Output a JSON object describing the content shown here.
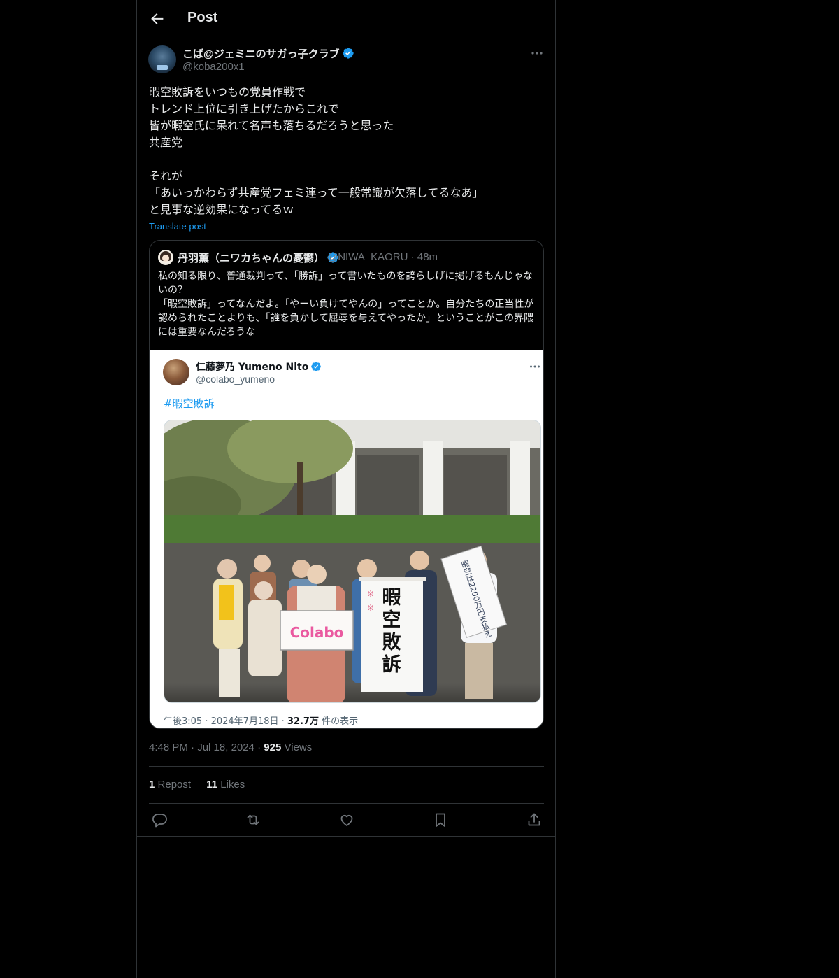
{
  "header": {
    "title": "Post"
  },
  "post": {
    "author_name": "こば@ジェミニのサガっ子クラブ",
    "author_handle": "@koba200x1",
    "body": "暇空敗訴をいつもの党員作戦で\nトレンド上位に引き上げたからこれで\n皆が暇空氏に呆れて名声も落ちるだろうと思った\n共産党\n\nそれが\n「あいっかわらず共産党フェミ連って一般常識が欠落してるなあ」\nと見事な逆効果になってるｗ",
    "translate_label": "Translate post",
    "time": "4:48 PM",
    "date": "Jul 18, 2024",
    "views_count": "925",
    "views_label": "Views",
    "reposts_count": "1",
    "reposts_label": "Repost",
    "likes_count": "11",
    "likes_label": "Likes"
  },
  "quote": {
    "author_name": "丹羽薫（ニワカちゃんの憂鬱）",
    "author_handle": "@NIWA_KAORU",
    "age": "48m",
    "text": "私の知る限り、普通裁判って、「勝訴」って書いたものを誇らしげに掲げるもんじゃないの？\n「暇空敗訴」ってなんだよ。「やーい負けてやんの」ってことか。自分たちの正当性が認められたことよりも、「誰を負かして屈辱を与えてやったか」ということがこの界隈には重要なんだろうな"
  },
  "embed": {
    "author_name": "仁藤夢乃 Yumeno Nito",
    "author_handle": "@colabo_yumeno",
    "hashtag": "#暇空敗訴",
    "photo": {
      "banner_text": [
        "暇",
        "空",
        "敗",
        "訴"
      ],
      "sign_text": "Colabo",
      "handwritten_sign": "暇空は2200万円支払え"
    },
    "footer_time": "午後3:05 · 2024年7月18日 · ",
    "footer_views_count": "32.7万",
    "footer_views_label": " 件の表示"
  },
  "icons": {
    "back": "arrow-left-icon",
    "more": "more-horizontal-icon",
    "verified": "verified-badge-icon",
    "reply": "reply-icon",
    "repost": "repost-icon",
    "like": "heart-icon",
    "bookmark": "bookmark-icon",
    "share": "share-icon"
  },
  "colors": {
    "accent": "#1d9bf0",
    "background": "#000000",
    "secondary_text": "#71767b",
    "border": "#2f3336"
  }
}
